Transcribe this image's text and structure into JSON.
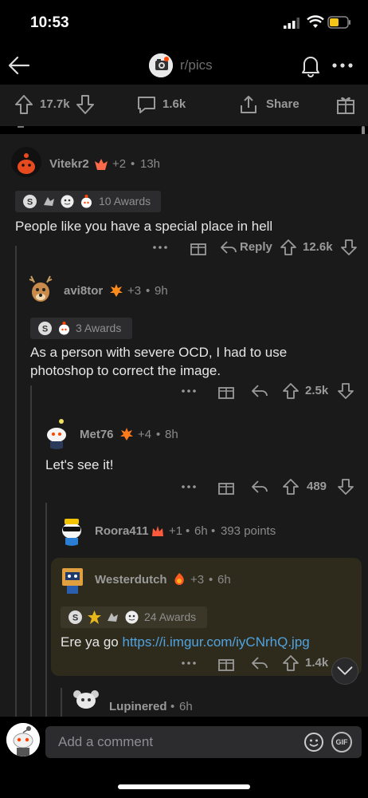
{
  "status": {
    "time": "10:53",
    "battery_color": "#f5c518"
  },
  "nav": {
    "subreddit": "r/pics"
  },
  "post_actions": {
    "upvotes": "17.7k",
    "comments": "1.6k",
    "share": "Share"
  },
  "comments": [
    {
      "user": "Vitekr2",
      "flair_extra": "+2",
      "age": "13h",
      "awards": "10 Awards",
      "body": "People like you have a special place in hell",
      "reply": "Reply",
      "score": "12.6k"
    },
    {
      "user": "avi8tor",
      "flair_extra": "+3",
      "age": "9h",
      "awards": "3 Awards",
      "body": "As a person with severe OCD, I had to use photoshop to correct the image.",
      "score": "2.5k"
    },
    {
      "user": "Met76",
      "flair_extra": "+4",
      "age": "8h",
      "body": "Let's see it!",
      "score": "489"
    },
    {
      "user": "Roora411",
      "flair_extra": "+1",
      "age": "6h",
      "points": "393 points"
    },
    {
      "user": "Westerdutch",
      "flair_extra": "+3",
      "age": "6h",
      "awards": "24 Awards",
      "body_prefix": "Ere ya go",
      "link": "https://i.imgur.com/iyCNrhQ.jpg",
      "score": "1.4k"
    },
    {
      "user": "Lupinered",
      "age": "6h"
    }
  ],
  "composer": {
    "placeholder": "Add a comment",
    "gif_label": "GIF"
  },
  "icons": [
    "back-arrow-icon",
    "bell-icon",
    "more-icon",
    "upvote-icon",
    "downvote-icon",
    "comment-icon",
    "share-icon",
    "award-icon",
    "reply-icon",
    "emoji-icon",
    "gif-icon",
    "chevron-down-icon"
  ],
  "colors": {
    "background": "#1a1a1b",
    "highlight": "#2e2a1c",
    "link": "#4fa3e0"
  }
}
